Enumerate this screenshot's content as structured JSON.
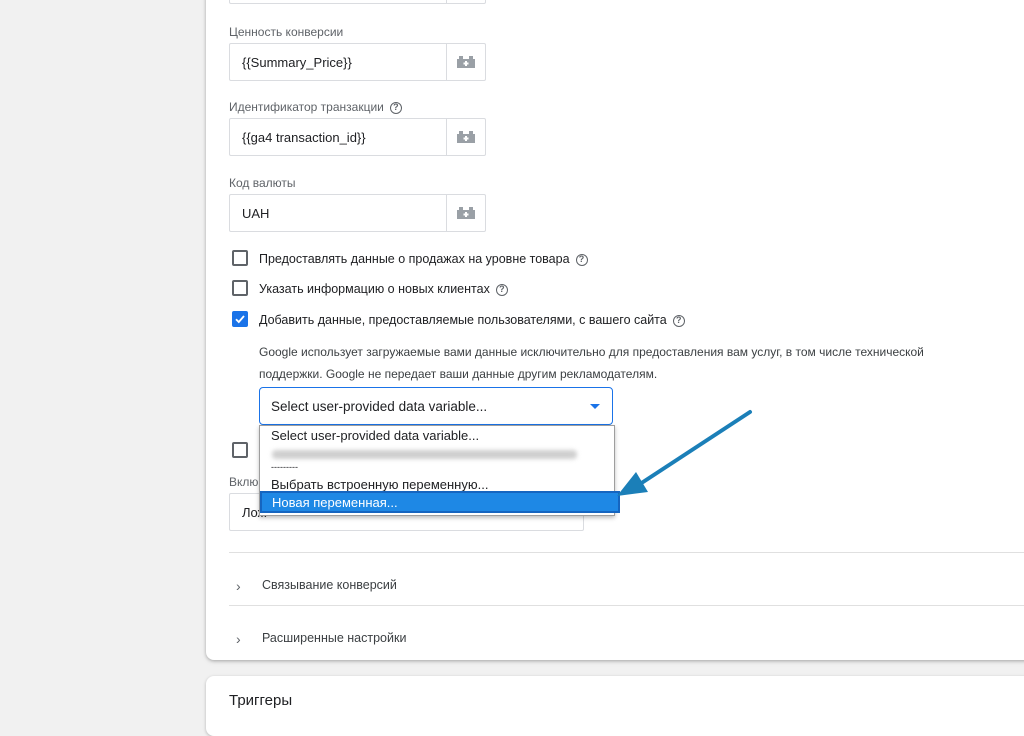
{
  "fields": {
    "conversion_value": {
      "label": "Ценность конверсии",
      "value": "{{Summary_Price}}"
    },
    "transaction_id": {
      "label": "Идентификатор транзакции",
      "value": "{{ga4 transaction_id}}"
    },
    "currency_code": {
      "label": "Код валюты",
      "value": "UAH"
    }
  },
  "help_glyph": "?",
  "checkboxes": [
    {
      "label": "Предоставлять данные о продажах на уровне товара",
      "checked": false
    },
    {
      "label": "Указать информацию о новых клиентах",
      "checked": false
    },
    {
      "label": "Добавить данные, предоставляемые пользователями, с вашего сайта",
      "checked": true
    }
  ],
  "user_data_description": "Google использует загружаемые вами данные исключительно для предоставления вам услуг, в том числе технической поддержки. Google не передает ваши данные другим рекламодателям.",
  "select": {
    "value": "Select user-provided data variable...",
    "options": [
      "Select user-provided data variable...",
      "---------",
      "Выбрать встроенную переменную...",
      "Новая переменная..."
    ]
  },
  "partially_hidden": {
    "label": "Вклю",
    "value": "Лож"
  },
  "sections": [
    {
      "label": "Связывание конверсий"
    },
    {
      "label": "Расширенные настройки"
    }
  ],
  "next_card": {
    "title": "Триггеры"
  },
  "colors": {
    "accent": "#1a73e8",
    "annotation_arrow": "#1b7fb8",
    "highlight": "#1e88e5"
  }
}
